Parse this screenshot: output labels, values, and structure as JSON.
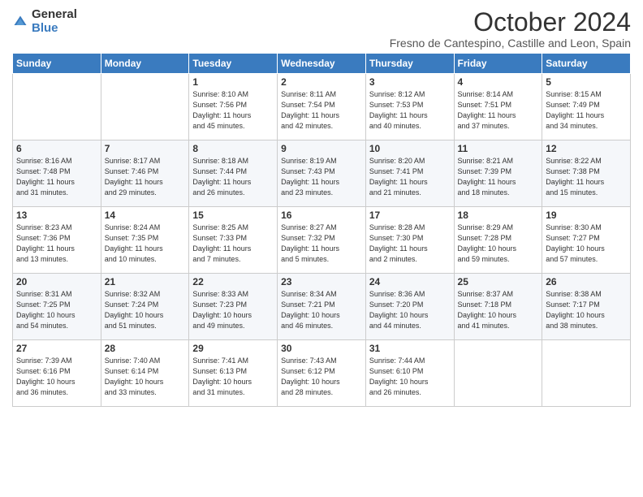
{
  "logo": {
    "general": "General",
    "blue": "Blue"
  },
  "header": {
    "title": "October 2024",
    "subtitle": "Fresno de Cantespino, Castille and Leon, Spain"
  },
  "days": [
    "Sunday",
    "Monday",
    "Tuesday",
    "Wednesday",
    "Thursday",
    "Friday",
    "Saturday"
  ],
  "weeks": [
    [
      {
        "day": "",
        "detail": ""
      },
      {
        "day": "",
        "detail": ""
      },
      {
        "day": "1",
        "detail": "Sunrise: 8:10 AM\nSunset: 7:56 PM\nDaylight: 11 hours\nand 45 minutes."
      },
      {
        "day": "2",
        "detail": "Sunrise: 8:11 AM\nSunset: 7:54 PM\nDaylight: 11 hours\nand 42 minutes."
      },
      {
        "day": "3",
        "detail": "Sunrise: 8:12 AM\nSunset: 7:53 PM\nDaylight: 11 hours\nand 40 minutes."
      },
      {
        "day": "4",
        "detail": "Sunrise: 8:14 AM\nSunset: 7:51 PM\nDaylight: 11 hours\nand 37 minutes."
      },
      {
        "day": "5",
        "detail": "Sunrise: 8:15 AM\nSunset: 7:49 PM\nDaylight: 11 hours\nand 34 minutes."
      }
    ],
    [
      {
        "day": "6",
        "detail": "Sunrise: 8:16 AM\nSunset: 7:48 PM\nDaylight: 11 hours\nand 31 minutes."
      },
      {
        "day": "7",
        "detail": "Sunrise: 8:17 AM\nSunset: 7:46 PM\nDaylight: 11 hours\nand 29 minutes."
      },
      {
        "day": "8",
        "detail": "Sunrise: 8:18 AM\nSunset: 7:44 PM\nDaylight: 11 hours\nand 26 minutes."
      },
      {
        "day": "9",
        "detail": "Sunrise: 8:19 AM\nSunset: 7:43 PM\nDaylight: 11 hours\nand 23 minutes."
      },
      {
        "day": "10",
        "detail": "Sunrise: 8:20 AM\nSunset: 7:41 PM\nDaylight: 11 hours\nand 21 minutes."
      },
      {
        "day": "11",
        "detail": "Sunrise: 8:21 AM\nSunset: 7:39 PM\nDaylight: 11 hours\nand 18 minutes."
      },
      {
        "day": "12",
        "detail": "Sunrise: 8:22 AM\nSunset: 7:38 PM\nDaylight: 11 hours\nand 15 minutes."
      }
    ],
    [
      {
        "day": "13",
        "detail": "Sunrise: 8:23 AM\nSunset: 7:36 PM\nDaylight: 11 hours\nand 13 minutes."
      },
      {
        "day": "14",
        "detail": "Sunrise: 8:24 AM\nSunset: 7:35 PM\nDaylight: 11 hours\nand 10 minutes."
      },
      {
        "day": "15",
        "detail": "Sunrise: 8:25 AM\nSunset: 7:33 PM\nDaylight: 11 hours\nand 7 minutes."
      },
      {
        "day": "16",
        "detail": "Sunrise: 8:27 AM\nSunset: 7:32 PM\nDaylight: 11 hours\nand 5 minutes."
      },
      {
        "day": "17",
        "detail": "Sunrise: 8:28 AM\nSunset: 7:30 PM\nDaylight: 11 hours\nand 2 minutes."
      },
      {
        "day": "18",
        "detail": "Sunrise: 8:29 AM\nSunset: 7:28 PM\nDaylight: 10 hours\nand 59 minutes."
      },
      {
        "day": "19",
        "detail": "Sunrise: 8:30 AM\nSunset: 7:27 PM\nDaylight: 10 hours\nand 57 minutes."
      }
    ],
    [
      {
        "day": "20",
        "detail": "Sunrise: 8:31 AM\nSunset: 7:25 PM\nDaylight: 10 hours\nand 54 minutes."
      },
      {
        "day": "21",
        "detail": "Sunrise: 8:32 AM\nSunset: 7:24 PM\nDaylight: 10 hours\nand 51 minutes."
      },
      {
        "day": "22",
        "detail": "Sunrise: 8:33 AM\nSunset: 7:23 PM\nDaylight: 10 hours\nand 49 minutes."
      },
      {
        "day": "23",
        "detail": "Sunrise: 8:34 AM\nSunset: 7:21 PM\nDaylight: 10 hours\nand 46 minutes."
      },
      {
        "day": "24",
        "detail": "Sunrise: 8:36 AM\nSunset: 7:20 PM\nDaylight: 10 hours\nand 44 minutes."
      },
      {
        "day": "25",
        "detail": "Sunrise: 8:37 AM\nSunset: 7:18 PM\nDaylight: 10 hours\nand 41 minutes."
      },
      {
        "day": "26",
        "detail": "Sunrise: 8:38 AM\nSunset: 7:17 PM\nDaylight: 10 hours\nand 38 minutes."
      }
    ],
    [
      {
        "day": "27",
        "detail": "Sunrise: 7:39 AM\nSunset: 6:16 PM\nDaylight: 10 hours\nand 36 minutes."
      },
      {
        "day": "28",
        "detail": "Sunrise: 7:40 AM\nSunset: 6:14 PM\nDaylight: 10 hours\nand 33 minutes."
      },
      {
        "day": "29",
        "detail": "Sunrise: 7:41 AM\nSunset: 6:13 PM\nDaylight: 10 hours\nand 31 minutes."
      },
      {
        "day": "30",
        "detail": "Sunrise: 7:43 AM\nSunset: 6:12 PM\nDaylight: 10 hours\nand 28 minutes."
      },
      {
        "day": "31",
        "detail": "Sunrise: 7:44 AM\nSunset: 6:10 PM\nDaylight: 10 hours\nand 26 minutes."
      },
      {
        "day": "",
        "detail": ""
      },
      {
        "day": "",
        "detail": ""
      }
    ]
  ]
}
